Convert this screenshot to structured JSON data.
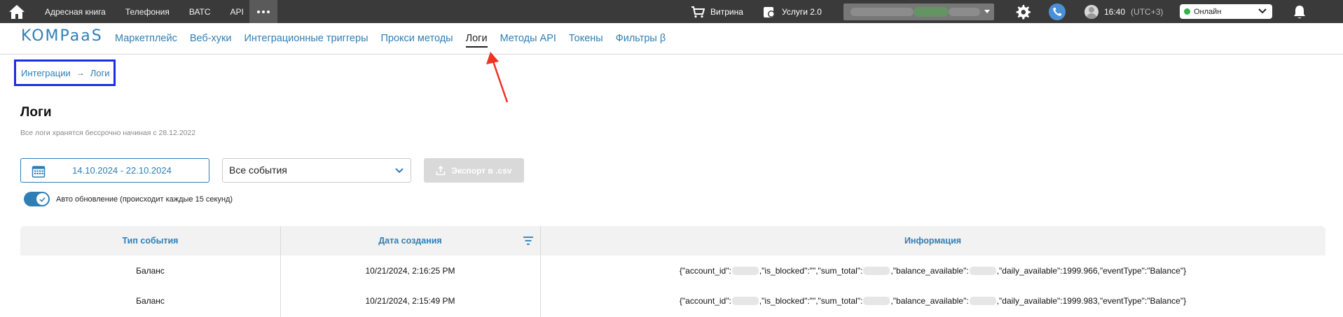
{
  "topbar": {
    "nav": [
      "Адресная книга",
      "Телефония",
      "ВАТС",
      "API"
    ],
    "shop_label": "Витрина",
    "services_label": "Услуги 2.0",
    "time": "16:40",
    "timezone": "(UTC+3)",
    "status": "Онлайн",
    "status_color": "#36b24a"
  },
  "subnav": {
    "logo": "KOMPaaS",
    "items": [
      "Маркетплейс",
      "Веб-хуки",
      "Интеграционные триггеры",
      "Прокси методы",
      "Логи",
      "Методы API",
      "Токены",
      "Фильтры β"
    ],
    "active_index": 4
  },
  "breadcrumb": {
    "parent": "Интеграции",
    "separator": "→",
    "current": "Логи"
  },
  "page": {
    "title": "Логи",
    "subtitle": "Все логи хранятся бессрочно начиная с 28.12.2022"
  },
  "filters": {
    "date_range": "14.10.2024 - 22.10.2024",
    "event_type": "Все события",
    "export_label": "Экспорт в .csv",
    "auto_update_label": "Авто обновление (происходит каждые 15 секунд)",
    "auto_update_on": true
  },
  "table": {
    "columns": [
      "Тип события",
      "Дата создания",
      "Информация"
    ],
    "rows": [
      {
        "type": "Баланс",
        "date": "10/21/2024, 2:16:25 PM",
        "info": {
          "p1": "{\"account_id\":",
          "p2": ",\"is_blocked\":\"\",\"sum_total\":",
          "p3": ",\"balance_available\":",
          "p4": ",\"daily_available\":1999.966,\"eventType\":\"Balance\"}"
        }
      },
      {
        "type": "Баланс",
        "date": "10/21/2024, 2:15:49 PM",
        "info": {
          "p1": "{\"account_id\":",
          "p2": ",\"is_blocked\":\"\",\"sum_total\":",
          "p3": ",\"balance_available\":",
          "p4": ",\"daily_available\":1999.983,\"eventType\":\"Balance\"}"
        }
      }
    ]
  },
  "colors": {
    "accent": "#2f7fb5",
    "topbar_bg": "#3a3a3a",
    "highlight_box": "#1a2fe0",
    "annotation_arrow": "#ee3324"
  }
}
